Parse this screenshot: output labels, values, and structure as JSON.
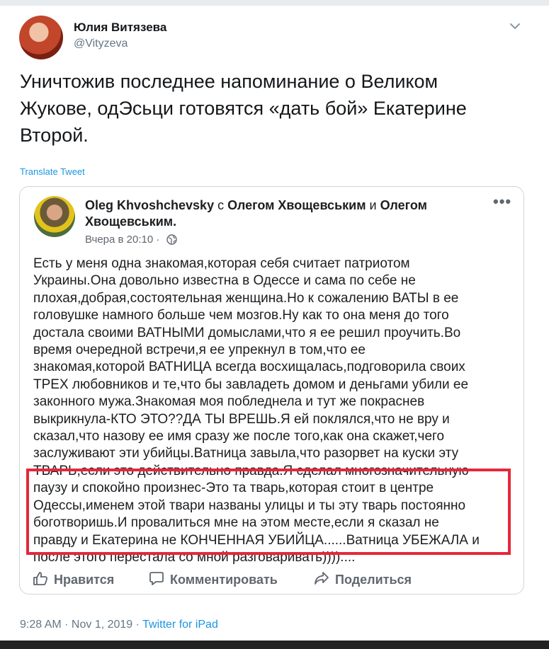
{
  "tweet": {
    "author_name": "Юлия Витязева",
    "author_handle": "@Vityzeva",
    "text": "Уничтожив последнее напоминание о Великом\nЖукове, одЭсьци готовятся «дать бой» Екатерине\nВторой.",
    "translate_label": "Translate Tweet",
    "time": "9:28 AM",
    "date": "Nov 1, 2019",
    "separator": " · ",
    "source": "Twitter for iPad"
  },
  "fb_post": {
    "author": "Oleg Khvoshchevsky",
    "with_word": "с",
    "tagged_1": "Олегом Хвощевським",
    "and_word": "и",
    "tagged_2": "Олегом Хвощевським.",
    "timestamp": "Вчера в 20:10",
    "meta_separator": " · ",
    "body": "Есть у меня одна знакомая,которая себя считает патриотом\nУкраины.Она довольно известна в Одессе и сама по себе не\nплохая,добрая,состоятельная женщина.Но к сожалению ВАТЫ в ее\nголовушке намного больше чем мозгов.Ну как то она меня до того\nдостала своими ВАТНЫМИ домыслами,что я ее решил проучить.Во\nвремя очередной встречи,я ее упрекнул в том,что ее\nзнакомая,которой ВАТНИЦА всегда восхищалась,подговорила своих\nТРЕХ любовников и те,что бы завладеть домом и деньгами убили ее\nзаконного  мужа.Знакомая моя побледнела и тут же покраснев\nвыкрикнула-КТО ЭТО??ДА ТЫ ВРЕШЬ.Я ей поклялся,что не вру и\nсказал,что назову ее имя сразу же после того,как она скажет,чего\nзаслуживают эти убийцы.Ватница завыла,что разорвет на куски эту\nТВАРЬ,если это действительно правда.Я сделал многозначительную\nпаузу и спокойно произнес-Это та тварь,которая стоит в центре\nОдессы,именем этой твари названы улицы и ты эту тварь постоянно\nбоготворишь.И провалиться мне на этом месте,если я сказал не\nправду и Екатерина не КОНЧЕННАЯ УБИЙЦА......Ватница УБЕЖАЛА и\nпосле этого перестала со мной разговаривать))))....",
    "actions": {
      "like": "Нравится",
      "comment": "Комментировать",
      "share": "Поделиться"
    }
  },
  "colors": {
    "link": "#1b95e0",
    "highlight": "#e5283a"
  },
  "icons": [
    "chevron-down-icon",
    "more-icon",
    "globe-icon",
    "like-icon",
    "comment-icon",
    "share-icon"
  ]
}
